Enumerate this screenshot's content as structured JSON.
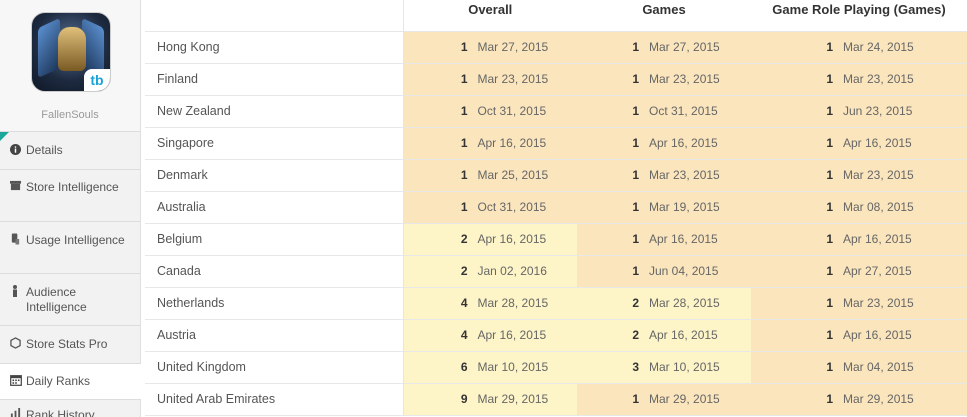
{
  "app": {
    "name": "FallenSouls",
    "badge": "tb"
  },
  "nav": [
    {
      "key": "details",
      "label": "Details",
      "icon": "info-icon"
    },
    {
      "key": "store",
      "label": "Store Intelligence",
      "icon": "store-icon"
    },
    {
      "key": "usage",
      "label": "Usage Intelligence",
      "icon": "usage-icon"
    },
    {
      "key": "audience",
      "label": "Audience Intelligence",
      "icon": "person-icon"
    },
    {
      "key": "stats",
      "label": "Store Stats Pro",
      "icon": "hexagon-icon"
    },
    {
      "key": "daily",
      "label": "Daily Ranks",
      "icon": "calendar-icon"
    },
    {
      "key": "history",
      "label": "Rank History",
      "icon": "chart-icon"
    }
  ],
  "table": {
    "headers": [
      "",
      "Overall",
      "Games",
      "Game Role Playing (Games)"
    ],
    "rows": [
      {
        "country": "Hong Kong",
        "cells": [
          [
            "1",
            "Mar 27, 2015"
          ],
          [
            "1",
            "Mar 27, 2015"
          ],
          [
            "1",
            "Mar 24, 2015"
          ]
        ]
      },
      {
        "country": "Finland",
        "cells": [
          [
            "1",
            "Mar 23, 2015"
          ],
          [
            "1",
            "Mar 23, 2015"
          ],
          [
            "1",
            "Mar 23, 2015"
          ]
        ]
      },
      {
        "country": "New Zealand",
        "cells": [
          [
            "1",
            "Oct 31, 2015"
          ],
          [
            "1",
            "Oct 31, 2015"
          ],
          [
            "1",
            "Jun 23, 2015"
          ]
        ]
      },
      {
        "country": "Singapore",
        "cells": [
          [
            "1",
            "Apr 16, 2015"
          ],
          [
            "1",
            "Apr 16, 2015"
          ],
          [
            "1",
            "Apr 16, 2015"
          ]
        ]
      },
      {
        "country": "Denmark",
        "cells": [
          [
            "1",
            "Mar 25, 2015"
          ],
          [
            "1",
            "Mar 23, 2015"
          ],
          [
            "1",
            "Mar 23, 2015"
          ]
        ]
      },
      {
        "country": "Australia",
        "cells": [
          [
            "1",
            "Oct 31, 2015"
          ],
          [
            "1",
            "Mar 19, 2015"
          ],
          [
            "1",
            "Mar 08, 2015"
          ]
        ]
      },
      {
        "country": "Belgium",
        "cells": [
          [
            "2",
            "Apr 16, 2015"
          ],
          [
            "1",
            "Apr 16, 2015"
          ],
          [
            "1",
            "Apr 16, 2015"
          ]
        ]
      },
      {
        "country": "Canada",
        "cells": [
          [
            "2",
            "Jan 02, 2016"
          ],
          [
            "1",
            "Jun 04, 2015"
          ],
          [
            "1",
            "Apr 27, 2015"
          ]
        ]
      },
      {
        "country": "Netherlands",
        "cells": [
          [
            "4",
            "Mar 28, 2015"
          ],
          [
            "2",
            "Mar 28, 2015"
          ],
          [
            "1",
            "Mar 23, 2015"
          ]
        ]
      },
      {
        "country": "Austria",
        "cells": [
          [
            "4",
            "Apr 16, 2015"
          ],
          [
            "2",
            "Apr 16, 2015"
          ],
          [
            "1",
            "Apr 16, 2015"
          ]
        ]
      },
      {
        "country": "United Kingdom",
        "cells": [
          [
            "6",
            "Mar 10, 2015"
          ],
          [
            "3",
            "Mar 10, 2015"
          ],
          [
            "1",
            "Mar 04, 2015"
          ]
        ]
      },
      {
        "country": "United Arab Emirates",
        "cells": [
          [
            "9",
            "Mar 29, 2015"
          ],
          [
            "1",
            "Mar 29, 2015"
          ],
          [
            "1",
            "Mar 29, 2015"
          ]
        ]
      }
    ]
  },
  "colors": {
    "rank_one": "#fbe5bd",
    "rank_other": "#fdf4c8",
    "accent": "#1ba89a"
  }
}
